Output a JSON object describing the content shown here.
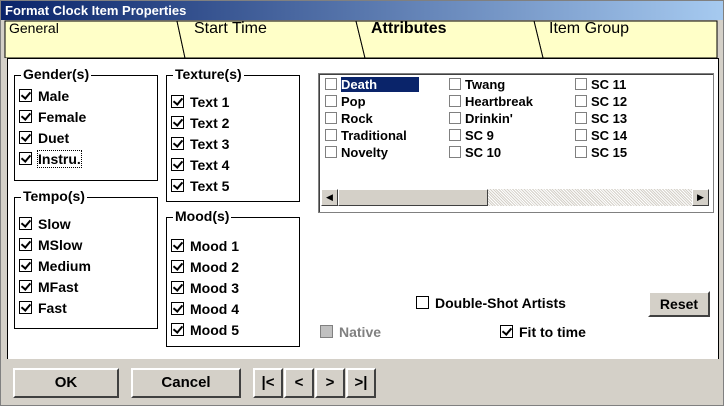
{
  "window": {
    "title": "Format Clock Item Properties"
  },
  "tabs": [
    {
      "label": "General"
    },
    {
      "label": "Start Time"
    },
    {
      "label": "Attributes"
    },
    {
      "label": "Item Group"
    }
  ],
  "gender": {
    "title": "Gender(s)",
    "items": [
      {
        "label": "Male",
        "checked": true
      },
      {
        "label": "Female",
        "checked": true
      },
      {
        "label": "Duet",
        "checked": true
      },
      {
        "label": "Instru.",
        "checked": true
      }
    ]
  },
  "tempo": {
    "title": "Tempo(s)",
    "items": [
      {
        "label": "Slow",
        "checked": true
      },
      {
        "label": "MSlow",
        "checked": true
      },
      {
        "label": "Medium",
        "checked": true
      },
      {
        "label": "MFast",
        "checked": true
      },
      {
        "label": "Fast",
        "checked": true
      }
    ]
  },
  "texture": {
    "title": "Texture(s)",
    "items": [
      {
        "label": "Text 1",
        "checked": true
      },
      {
        "label": "Text 2",
        "checked": true
      },
      {
        "label": "Text 3",
        "checked": true
      },
      {
        "label": "Text 4",
        "checked": true
      },
      {
        "label": "Text 5",
        "checked": true
      }
    ]
  },
  "mood": {
    "title": "Mood(s)",
    "items": [
      {
        "label": "Mood 1",
        "checked": true
      },
      {
        "label": "Mood 2",
        "checked": true
      },
      {
        "label": "Mood 3",
        "checked": true
      },
      {
        "label": "Mood 4",
        "checked": true
      },
      {
        "label": "Mood 5",
        "checked": true
      }
    ]
  },
  "attributes_list": {
    "col1": [
      "Death",
      "Pop",
      "Rock",
      "Traditional",
      "Novelty"
    ],
    "col2": [
      "Twang",
      "Heartbreak",
      "Drinkin'",
      "SC 9",
      "SC 10"
    ],
    "col3": [
      "SC 11",
      "SC 12",
      "SC 13",
      "SC 14",
      "SC 15"
    ],
    "selected": "Death"
  },
  "options": {
    "double_shot": {
      "label": "Double-Shot Artists",
      "checked": false
    },
    "native": {
      "label": "Native",
      "checked": false,
      "enabled": false
    },
    "fit_to_time": {
      "label": "Fit to time",
      "checked": true
    }
  },
  "buttons": {
    "reset": "Reset",
    "ok": "OK",
    "cancel": "Cancel",
    "first": "|<",
    "prev": "<",
    "next": ">",
    "last": ">|"
  },
  "colors": {
    "tab_bg": "#ffffc8",
    "title_bar": "#0a246a",
    "selection": "#0a246a"
  }
}
